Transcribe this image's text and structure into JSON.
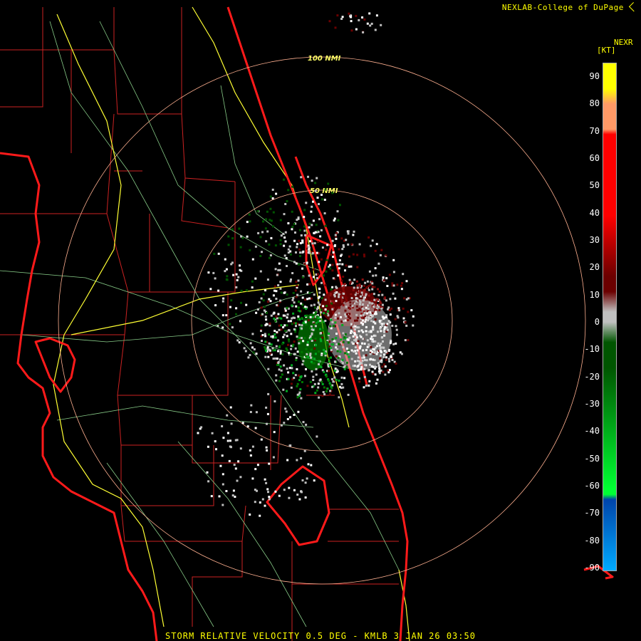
{
  "header": {
    "credit": "NEXLAB-College of DuPage",
    "credit_icon": "arrow-cursor-icon"
  },
  "legend": {
    "product": "NEXR",
    "unit": "[KT]",
    "ticks": [
      "90",
      "80",
      "70",
      "60",
      "50",
      "40",
      "30",
      "20",
      "10",
      "0",
      "-10",
      "-20",
      "-30",
      "-40",
      "-50",
      "-60",
      "-70",
      "-80",
      "-90"
    ],
    "colors": {
      "top": "#ffff00",
      "orange": "#ff9966",
      "red": "#ff0000",
      "darkred": "#6b0000",
      "gray": "#c0c0c0",
      "darkgreen": "#005500",
      "green": "#00ff33",
      "blue": "#0044aa",
      "cyan": "#00aaff"
    }
  },
  "range_rings": {
    "inner_label": "50 NMI",
    "outer_label": "100 NMI",
    "color": "#ffb090"
  },
  "map_colors": {
    "coast": "#ff1a1a",
    "county": "#cc2222",
    "interstate": "#ffff33",
    "roads": "#88cc88"
  },
  "footer": {
    "caption": "STORM RELATIVE VELOCITY 0.5 DEG - KMLB 3 JAN 26 03:50"
  }
}
